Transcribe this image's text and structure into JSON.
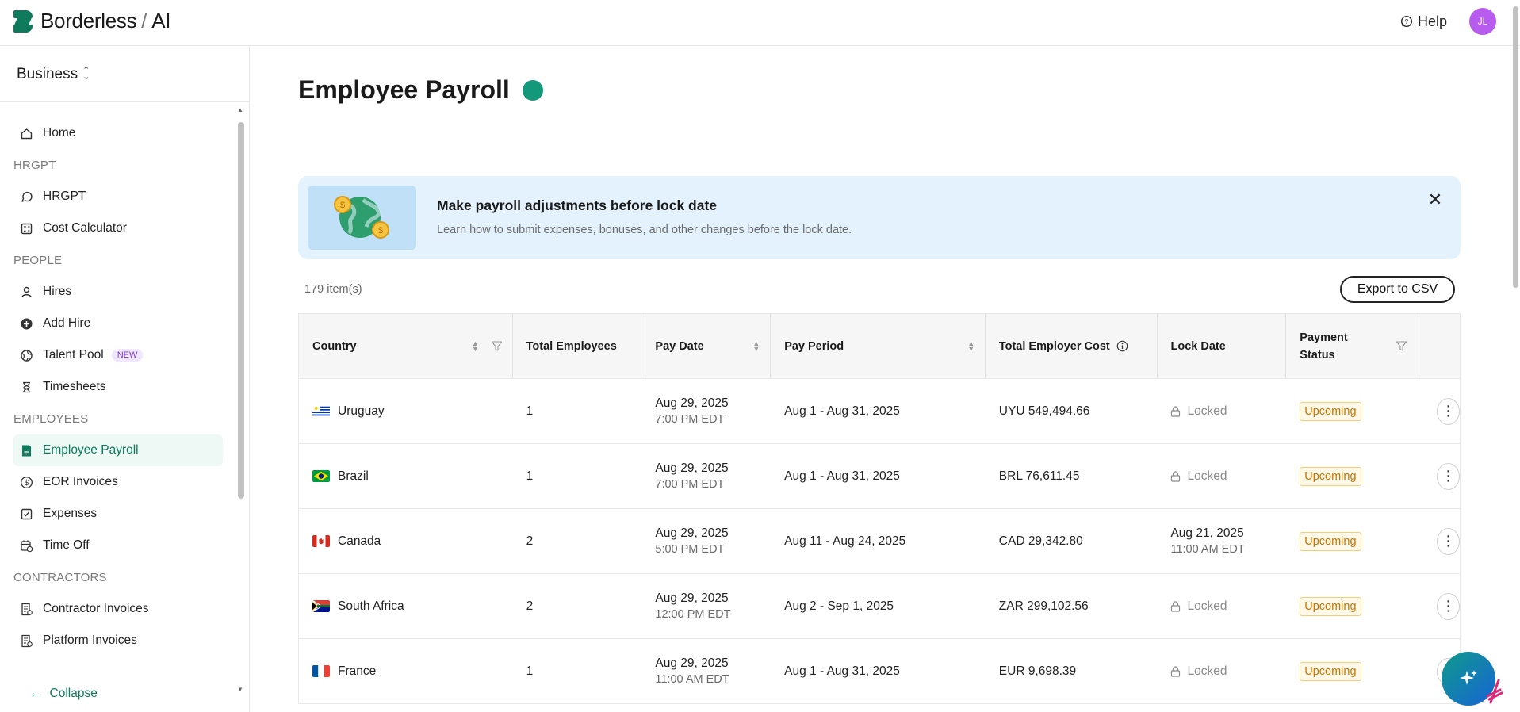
{
  "brand": {
    "name": "Borderless",
    "suffix": "AI"
  },
  "header": {
    "help_label": "Help",
    "avatar_initials": "JL"
  },
  "sidebar": {
    "workspace": "Business",
    "sections": {
      "hrgpt": "HRGPT",
      "people": "PEOPLE",
      "employees": "EMPLOYEES",
      "contractors": "CONTRACTORS"
    },
    "items": {
      "home": "Home",
      "hrgpt": "HRGPT",
      "cost_calculator": "Cost Calculator",
      "hires": "Hires",
      "add_hire": "Add Hire",
      "talent_pool": "Talent Pool",
      "talent_pool_badge": "NEW",
      "timesheets": "Timesheets",
      "employee_payroll": "Employee Payroll",
      "eor_invoices": "EOR Invoices",
      "expenses": "Expenses",
      "time_off": "Time Off",
      "contractor_invoices": "Contractor Invoices",
      "platform_invoices": "Platform Invoices"
    },
    "collapse_label": "Collapse"
  },
  "main": {
    "title": "Employee Payroll",
    "banner": {
      "title": "Make payroll adjustments before lock date",
      "subtitle": "Learn how to submit expenses, bonuses, and other changes before the lock date."
    },
    "item_count": "179 item(s)",
    "export_label": "Export to CSV"
  },
  "table": {
    "headers": {
      "country": "Country",
      "total_employees": "Total Employees",
      "pay_date": "Pay Date",
      "pay_period": "Pay Period",
      "total_employer_cost": "Total Employer Cost",
      "lock_date": "Lock Date",
      "payment_status_1": "Payment",
      "payment_status_2": "Status"
    },
    "rows": [
      {
        "country": "Uruguay",
        "employees": "1",
        "pay_date": "Aug 29, 2025",
        "pay_time": "7:00 PM EDT",
        "pay_period": "Aug 1 - Aug 31, 2025",
        "cost": "UYU 549,494.66",
        "lock": "Locked",
        "lock_time": "",
        "status": "Upcoming"
      },
      {
        "country": "Brazil",
        "employees": "1",
        "pay_date": "Aug 29, 2025",
        "pay_time": "7:00 PM EDT",
        "pay_period": "Aug 1 - Aug 31, 2025",
        "cost": "BRL 76,611.45",
        "lock": "Locked",
        "lock_time": "",
        "status": "Upcoming"
      },
      {
        "country": "Canada",
        "employees": "2",
        "pay_date": "Aug 29, 2025",
        "pay_time": "5:00 PM EDT",
        "pay_period": "Aug 11 - Aug 24, 2025",
        "cost": "CAD 29,342.80",
        "lock": "Aug 21, 2025",
        "lock_time": "11:00 AM EDT",
        "status": "Upcoming"
      },
      {
        "country": "South Africa",
        "employees": "2",
        "pay_date": "Aug 29, 2025",
        "pay_time": "12:00 PM EDT",
        "pay_period": "Aug 2 - Sep 1, 2025",
        "cost": "ZAR 299,102.56",
        "lock": "Locked",
        "lock_time": "",
        "status": "Upcoming"
      },
      {
        "country": "France",
        "employees": "1",
        "pay_date": "Aug 29, 2025",
        "pay_time": "11:00 AM EDT",
        "pay_period": "Aug 1 - Aug 31, 2025",
        "cost": "EUR 9,698.39",
        "lock": "Locked",
        "lock_time": "",
        "status": "Upcoming"
      }
    ]
  },
  "colors": {
    "brand": "#0f7a5c",
    "status_dot": "#13987a",
    "banner_bg": "#e3f2fd",
    "upcoming": "#c77700"
  }
}
